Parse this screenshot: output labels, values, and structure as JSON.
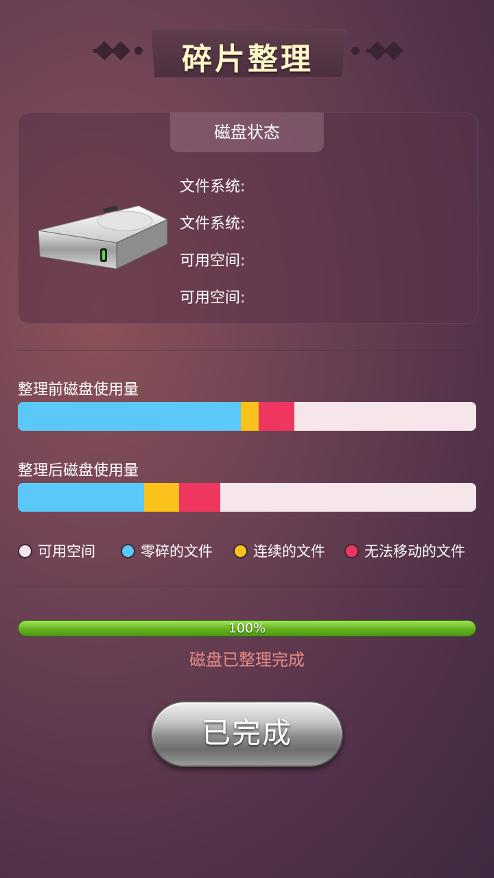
{
  "title": "碎片整理",
  "disk_status": {
    "tab_label": "磁盘状态",
    "info_rows": [
      "文件系统:",
      "文件系统:",
      "可用空间:",
      "可用空间:"
    ]
  },
  "before": {
    "label": "整理前磁盘使用量",
    "segments": [
      {
        "kind": "fragmented",
        "fraction": 0.486,
        "color": "#5ac9f8"
      },
      {
        "kind": "contiguous",
        "fraction": 0.039,
        "color": "#fbc21b"
      },
      {
        "kind": "unmovable",
        "fraction": 0.078,
        "color": "#ee3660"
      },
      {
        "kind": "free",
        "fraction": 0.397,
        "color": "#f6e6ea"
      }
    ]
  },
  "after": {
    "label": "整理后磁盘使用量",
    "segments": [
      {
        "kind": "fragmented",
        "fraction": 0.275,
        "color": "#5ac9f8"
      },
      {
        "kind": "contiguous",
        "fraction": 0.077,
        "color": "#fbc21b"
      },
      {
        "kind": "unmovable",
        "fraction": 0.09,
        "color": "#ee3660"
      },
      {
        "kind": "free",
        "fraction": 0.558,
        "color": "#f6e6ea"
      }
    ]
  },
  "legend": [
    {
      "label": "可用空间",
      "color": "#f6e6ea"
    },
    {
      "label": "零碎的文件",
      "color": "#5ac9f8"
    },
    {
      "label": "连续的文件",
      "color": "#fbc21b"
    },
    {
      "label": "无法移动的文件",
      "color": "#ee3660"
    }
  ],
  "progress": {
    "value": 1.0,
    "text": "100%"
  },
  "status_text": "磁盘已整理完成",
  "done_button_label": "已完成"
}
